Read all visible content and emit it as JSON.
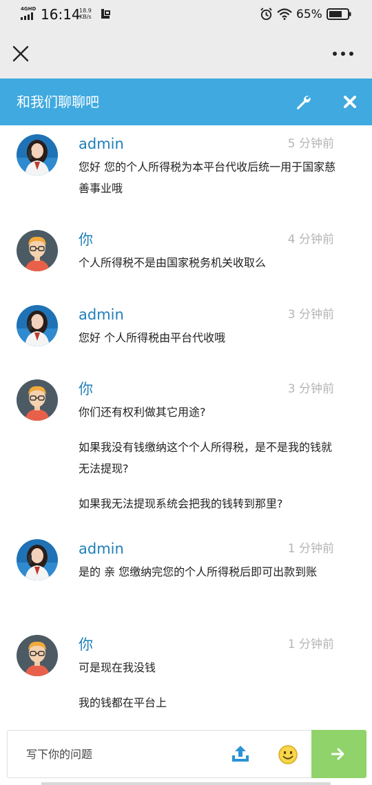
{
  "status_bar": {
    "network": "4GHD",
    "time": "16:14",
    "speed_value": "18.9",
    "speed_unit": "KB/s",
    "battery_percent": "65%"
  },
  "nav": {
    "close_icon": "close-icon",
    "more_icon": "more-dots-icon"
  },
  "chat_header": {
    "title": "和我们聊聊吧",
    "accent": "#3fa9e0"
  },
  "messages": [
    {
      "sender": "admin",
      "role": "agent",
      "time": "5 分钟前",
      "lines": [
        "您好 您的个人所得税为本平台代收后统一用于国家慈善事业哦"
      ]
    },
    {
      "sender": "你",
      "role": "user",
      "time": "4 分钟前",
      "lines": [
        "个人所得税不是由国家税务机关收取么"
      ]
    },
    {
      "sender": "admin",
      "role": "agent",
      "time": "3 分钟前",
      "lines": [
        "您好 个人所得税由平台代收哦"
      ]
    },
    {
      "sender": "你",
      "role": "user",
      "time": "3 分钟前",
      "lines": [
        "你们还有权利做其它用途?",
        "如果我没有钱缴纳这个个人所得税，是不是我的钱就无法提现?",
        "如果我无法提现系统会把我的钱转到那里?"
      ]
    },
    {
      "sender": "admin",
      "role": "agent",
      "time": "1 分钟前",
      "lines": [
        "是的 亲 您缴纳完您的个人所得税后即可出款到账"
      ]
    },
    {
      "sender": "你",
      "role": "user",
      "time": "1 分钟前",
      "lines": [
        "可是现在我没钱",
        "我的钱都在平台上"
      ]
    }
  ],
  "input": {
    "placeholder": "写下你的问题",
    "value": "",
    "send_color": "#8fd36a"
  }
}
